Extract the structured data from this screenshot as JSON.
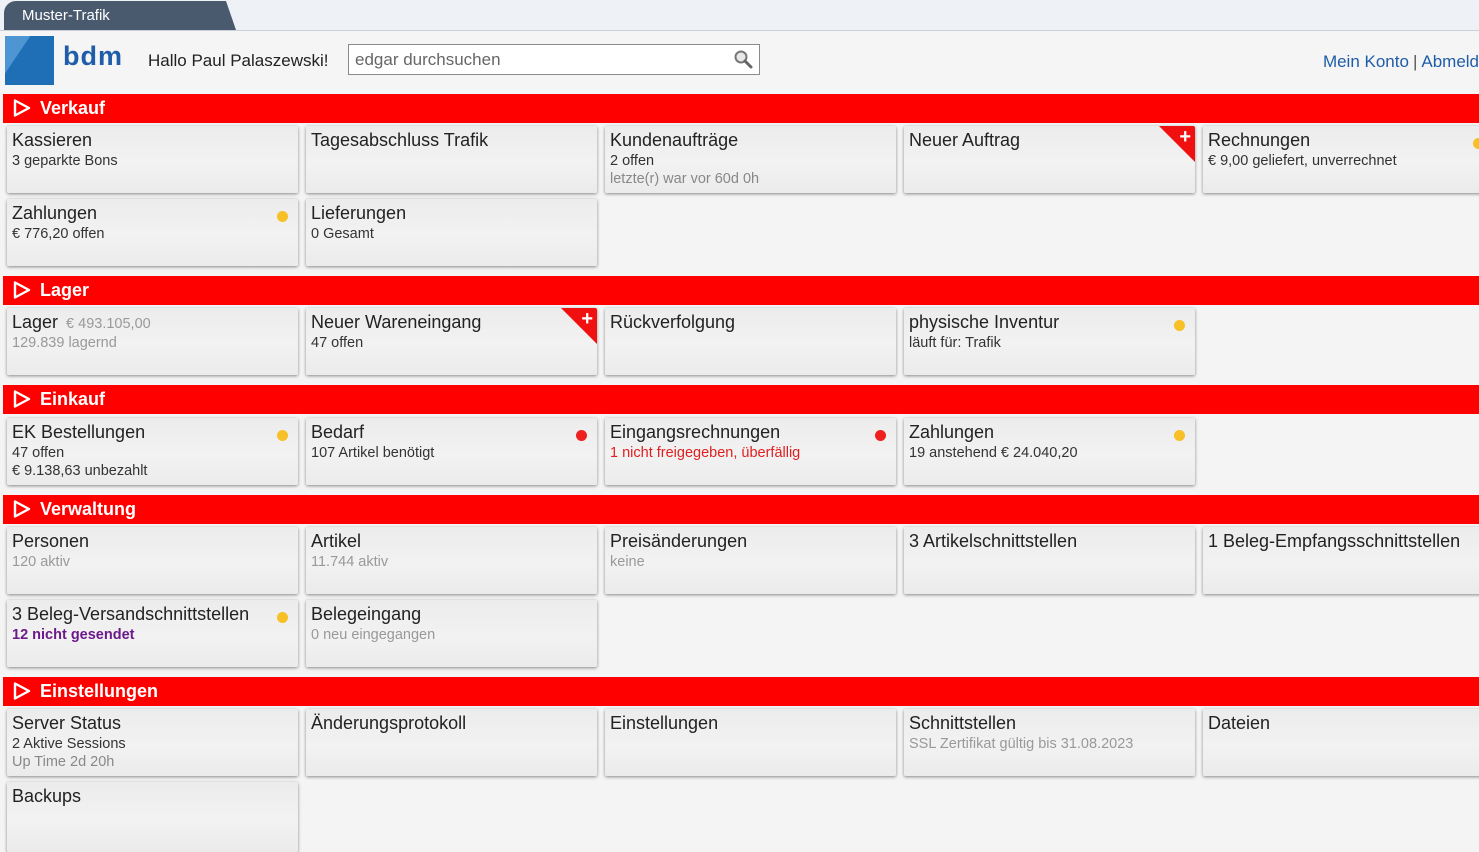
{
  "app": {
    "tab_label": "Muster-Trafik",
    "logo_text": "bdm",
    "greeting": "Hallo Paul Palaszewski!",
    "search_placeholder": "edgar durchsuchen",
    "account_link": "Mein Konto",
    "logout_link": "Abmeld",
    "colors": {
      "section": "#ff0000",
      "link": "#1f5da8",
      "dot_yellow": "#f6c026",
      "dot_red": "#ee2020"
    }
  },
  "sections": {
    "verkauf": {
      "title": "Verkauf",
      "tiles": {
        "kassieren": {
          "title": "Kassieren",
          "l1": "3 geparkte Bons"
        },
        "tagesabschluss": {
          "title": "Tagesabschluss Trafik"
        },
        "kundenauftraege": {
          "title": "Kundenaufträge",
          "l1": "2 offen",
          "l2": "letzte(r) war vor 60d 0h"
        },
        "neuer_auftrag": {
          "title": "Neuer Auftrag",
          "corner_icon": "+"
        },
        "rechnungen": {
          "title": "Rechnungen",
          "l1": "€ 9,00 geliefert, unverrechnet",
          "status": "yellow"
        },
        "zahlungen": {
          "title": "Zahlungen",
          "l1": "€ 776,20 offen",
          "status": "yellow"
        },
        "lieferungen": {
          "title": "Lieferungen",
          "l1": "0 Gesamt"
        }
      }
    },
    "lager": {
      "title": "Lager",
      "tiles": {
        "lager": {
          "title": "Lager",
          "inline": "€ 493.105,00",
          "l1": "129.839 lagernd"
        },
        "wareneingang": {
          "title": "Neuer Wareneingang",
          "l1": "47 offen",
          "corner_icon": "+"
        },
        "rueckverfolgung": {
          "title": "Rückverfolgung"
        },
        "inventur": {
          "title": "physische Inventur",
          "l1": "läuft für: Trafik",
          "status": "yellow"
        }
      }
    },
    "einkauf": {
      "title": "Einkauf",
      "tiles": {
        "ek_bestellungen": {
          "title": "EK Bestellungen",
          "l1": "47 offen",
          "l2": "€ 9.138,63 unbezahlt",
          "status": "yellow"
        },
        "bedarf": {
          "title": "Bedarf",
          "l1": "107 Artikel benötigt",
          "status": "red"
        },
        "eingangsrechnungen": {
          "title": "Eingangsrechnungen",
          "l1": "1 nicht freigegeben, überfällig",
          "status": "red"
        },
        "zahlungen": {
          "title": "Zahlungen",
          "l1": "19 anstehend € 24.040,20",
          "status": "yellow"
        }
      }
    },
    "verwaltung": {
      "title": "Verwaltung",
      "tiles": {
        "personen": {
          "title": "Personen",
          "l1": "120 aktiv"
        },
        "artikel": {
          "title": "Artikel",
          "l1": "11.744 aktiv"
        },
        "preisaenderungen": {
          "title": "Preisänderungen",
          "l1": "keine"
        },
        "artikelschnittstellen": {
          "title": "3 Artikelschnittstellen"
        },
        "beleg_empfang": {
          "title": "1 Beleg-Empfangsschnittstellen"
        },
        "beleg_versand": {
          "title": "3 Beleg-Versandschnittstellen",
          "l1": "12 nicht gesendet",
          "status": "yellow"
        },
        "belegeingang": {
          "title": "Belegeingang",
          "l1": "0 neu eingegangen"
        }
      }
    },
    "einstellungen": {
      "title": "Einstellungen",
      "tiles": {
        "server_status": {
          "title": "Server Status",
          "l1": "2 Aktive Sessions",
          "l2": "Up Time 2d 20h"
        },
        "aenderungsprotokoll": {
          "title": "Änderungsprotokoll"
        },
        "einstellungen": {
          "title": "Einstellungen"
        },
        "schnittstellen": {
          "title": "Schnittstellen",
          "l1": "SSL Zertifikat gültig bis 31.08.2023"
        },
        "dateien": {
          "title": "Dateien"
        },
        "backups": {
          "title": "Backups"
        }
      }
    }
  }
}
